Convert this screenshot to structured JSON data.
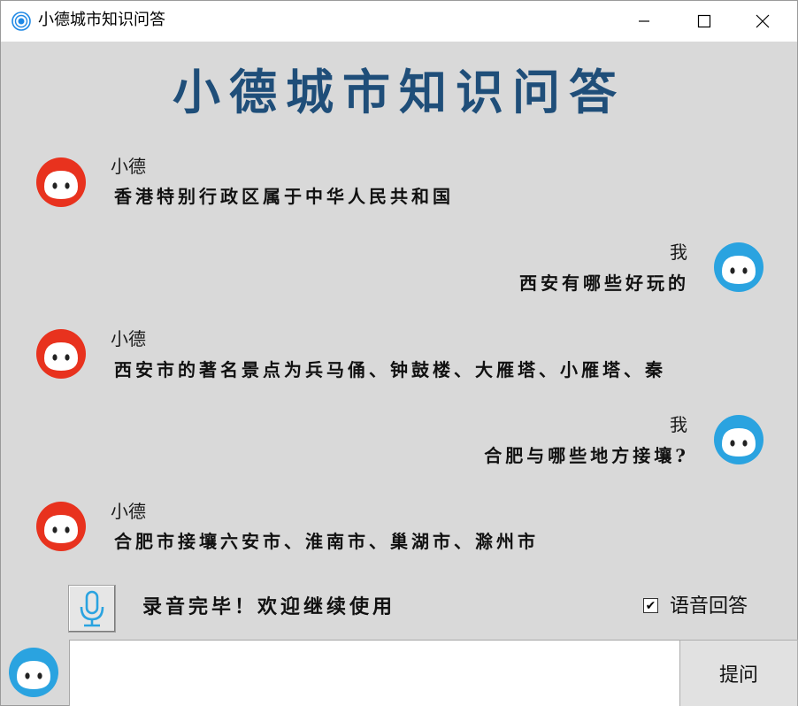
{
  "window": {
    "title": "小德城市知识问答"
  },
  "window_controls": {
    "minimize": "—",
    "maximize": "☐",
    "close": "✕"
  },
  "header": {
    "title": "小德城市知识问答"
  },
  "chat": {
    "messages": [
      {
        "sender": "小德",
        "text": "香港特别行政区属于中华人民共和国",
        "side": "left",
        "avatar": "red-face-avatar"
      },
      {
        "sender": "我",
        "text": "西安有哪些好玩的",
        "side": "right",
        "avatar": "blue-face-avatar"
      },
      {
        "sender": "小德",
        "text": "西安市的著名景点为兵马俑、钟鼓楼、大雁塔、小雁塔、秦",
        "side": "left",
        "avatar": "red-face-avatar"
      },
      {
        "sender": "我",
        "text": "合肥与哪些地方接壤?",
        "side": "right",
        "avatar": "blue-face-avatar"
      },
      {
        "sender": "小德",
        "text": "合肥市接壤六安市、淮南市、巢湖市、滁州市",
        "side": "left",
        "avatar": "red-face-avatar"
      }
    ]
  },
  "controls": {
    "mic_icon": "microphone-icon",
    "status": "录音完毕！欢迎继续使用",
    "voice_answer_label": "语音回答",
    "voice_answer_checked": true,
    "voice_answer_mark": "✔",
    "input_value": "",
    "ask_label": "提问"
  },
  "colors": {
    "bot_avatar": "#e8321e",
    "user_avatar": "#2aa3e0",
    "title": "#1f4e79",
    "background": "#d9d9d9"
  }
}
